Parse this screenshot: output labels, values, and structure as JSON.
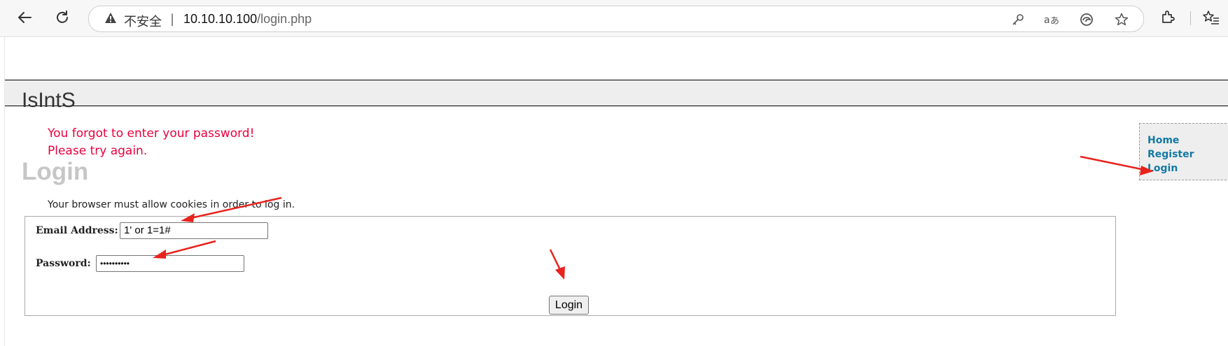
{
  "browser": {
    "security_label": "不安全",
    "separator": "|",
    "url_host": "10.10.10.100",
    "url_path": "/login.php"
  },
  "site": {
    "title": "IsIntS"
  },
  "messages": {
    "error_line1": "You forgot to enter your password!",
    "error_line2": "Please try again."
  },
  "login": {
    "heading": "Login",
    "cookie_notice": "Your browser must allow cookies in order to log in.",
    "email_label": "Email Address:",
    "email_value": "1' or 1=1#",
    "password_label": "Password:",
    "password_value": "••••••••••",
    "submit_label": "Login"
  },
  "sidebar": {
    "links": [
      "Home",
      "Register",
      "Login"
    ]
  },
  "colors": {
    "error": "#e8003c",
    "link": "#137aa3",
    "heading": "#c6c6c6",
    "annotation_arrow": "#e8231e"
  }
}
